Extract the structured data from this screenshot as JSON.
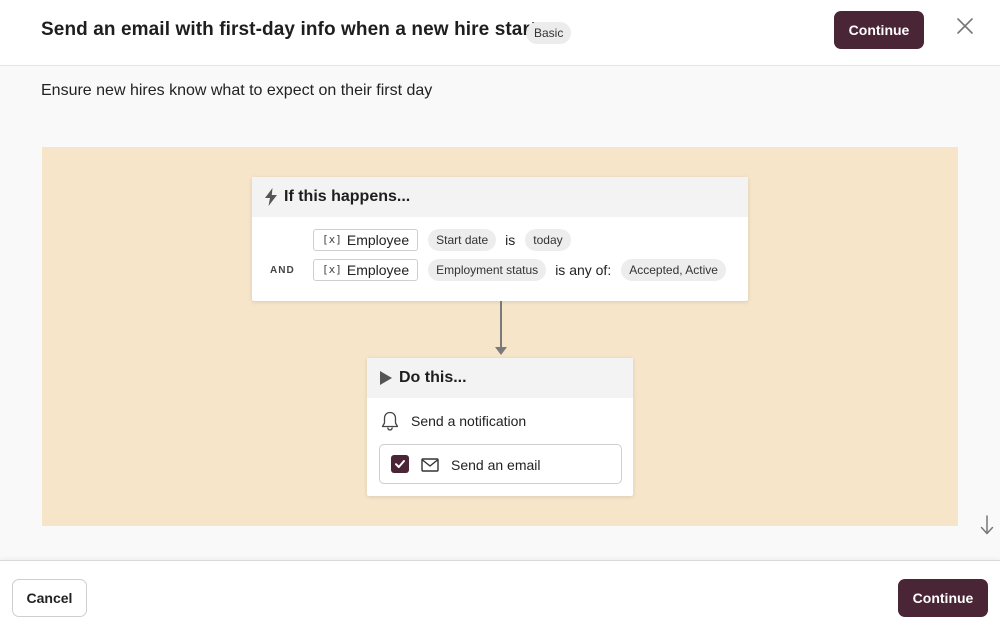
{
  "header": {
    "title": "Send an email with first-day info when a new hire starts",
    "badge": "Basic",
    "continue_label": "Continue",
    "close_icon": "close-icon"
  },
  "subtitle": "Ensure new hires know what to expect on their first day",
  "trigger": {
    "heading": "If this happens...",
    "heading_icon": "lightning-bolt-icon",
    "conditions": [
      {
        "conjunction": "",
        "variable_marker": "[x]",
        "variable": "Employee",
        "field": "Start date",
        "operator": "is",
        "value": "today"
      },
      {
        "conjunction": "AND",
        "variable_marker": "[x]",
        "variable": "Employee",
        "field": "Employment status",
        "operator": "is any of:",
        "value": "Accepted, Active"
      }
    ]
  },
  "action": {
    "heading": "Do this...",
    "heading_icon": "play-icon",
    "items": [
      {
        "label": "Send a notification",
        "icon": "bell-icon",
        "checked": false
      },
      {
        "label": "Send an email",
        "icon": "envelope-icon",
        "checked": true
      }
    ]
  },
  "footer": {
    "cancel_label": "Cancel",
    "continue_label": "Continue"
  },
  "colors": {
    "primary": "#4a2535",
    "canvas": "#f6e5c9",
    "header_bg": "#ffffff",
    "page_bg": "#f9f9f9"
  }
}
